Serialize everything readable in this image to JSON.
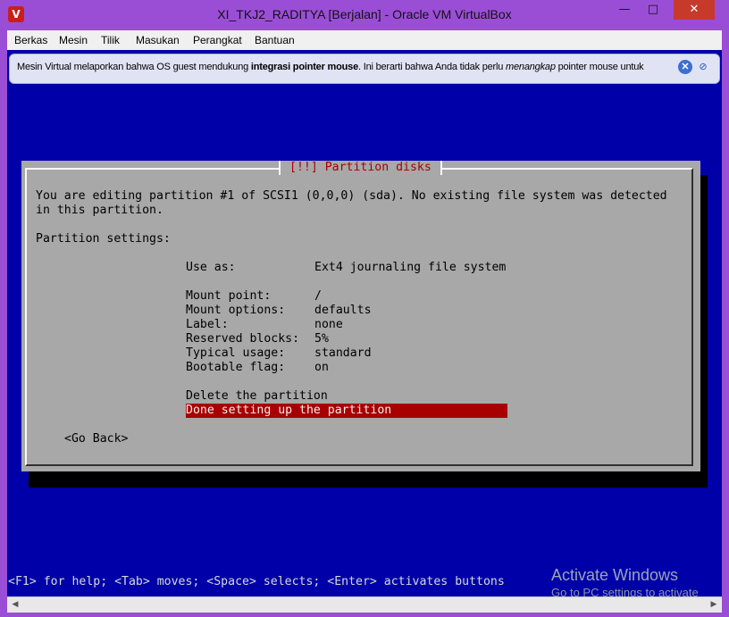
{
  "window": {
    "title": "XI_TKJ2_RADITYA [Berjalan] - Oracle VM VirtualBox",
    "icon": "virtualbox-icon",
    "buttons": {
      "minimize": "—",
      "maximize": "□",
      "close": "✕"
    }
  },
  "menu": [
    "Berkas",
    "Mesin",
    "Tilik",
    "Masukan",
    "Perangkat",
    "Bantuan"
  ],
  "notice": {
    "text_pre": "Mesin Virtual melaporkan bahwa OS guest mendukung ",
    "text_bold": "integrasi pointer mouse",
    "text_mid": ". Ini berarti bahwa Anda tidak perlu ",
    "text_italic": "menangkap",
    "text_post": " pointer mouse untuk"
  },
  "installer": {
    "title": "[!!] Partition disks",
    "intro_line1": "You are editing partition #1 of SCSI1 (0,0,0) (sda). No existing file system was detected",
    "intro_line2": "in this partition.",
    "settings_label": "Partition settings:",
    "settings": [
      {
        "key": "Use as:",
        "value": "Ext4 journaling file system"
      },
      {
        "key": "Mount point:",
        "value": "/"
      },
      {
        "key": "Mount options:",
        "value": "defaults"
      },
      {
        "key": "Label:",
        "value": "none"
      },
      {
        "key": "Reserved blocks:",
        "value": "5%"
      },
      {
        "key": "Typical usage:",
        "value": "standard"
      },
      {
        "key": "Bootable flag:",
        "value": "on"
      }
    ],
    "actions": [
      "Delete the partition",
      "Done setting up the partition"
    ],
    "go_back": "<Go Back>",
    "hint": "<F1> for help; <Tab> moves; <Space> selects; <Enter> activates buttons"
  },
  "watermark": {
    "line1": "Activate Windows",
    "line2": "Go to PC settings to activate"
  },
  "colors": {
    "console_bg": "#0000a8",
    "dialog_bg": "#a8a8a8",
    "selection": "#a80000",
    "window_frame": "#9a4ed6"
  }
}
